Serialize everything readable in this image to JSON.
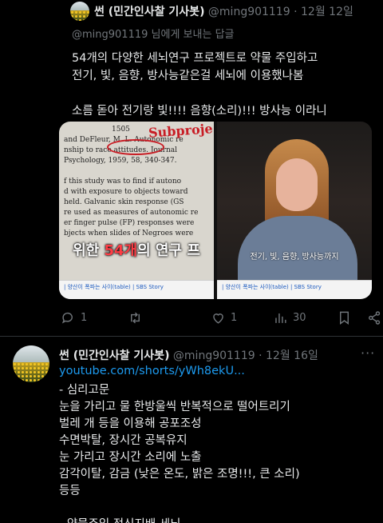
{
  "tweet1": {
    "author_name": "썬 (민간인사찰 기사봇)",
    "handle": "@ming901119",
    "separator": "·",
    "date": "12월 12일",
    "reply_to_handle": "@ming901119",
    "reply_to_suffix": " 님에게 보내는 답글",
    "body_lines": [
      "54개의 다양한 세뇌연구 프로젝트로 약물 주입하고",
      "전기, 빛, 음향, 방사능같은걸 세뇌에 이용했나봄",
      "",
      "소름 돋아 전기랑 빛!!!! 음향(소리)!!! 방사능 이라니"
    ],
    "media": {
      "left_image": {
        "doc_text": [
          "1505",
          "and DeFleur, M. L. Autonomic re",
          "nship to race attitudes. Journal",
          "Psychology, 1959, 58, 340-347.",
          "",
          "f this study was to find if autono",
          "d with exposure to objects toward",
          "held. Galvanic skin response (GS",
          "re used as measures of autonomic re",
          "er finger pulse (FP) responses were",
          "bjects when slides of Negroes were"
        ],
        "handwriting": "Subproje",
        "caption_before": "위한 ",
        "caption_highlight": "54개",
        "caption_after": "의 연구 프",
        "bar_text": "| 양산이 폭파는 사이(table) | SBS Story"
      },
      "right_image": {
        "subtitle": "전기, 빛, 음향, 방사능까지",
        "bar_text": "| 양산이 폭파는 사이(table) | SBS Story"
      }
    },
    "actions": {
      "reply_count": "1",
      "retweet_count": "",
      "like_count": "1",
      "view_count": "30"
    }
  },
  "tweet2": {
    "author_name": "썬 (민간인사찰 기사봇)",
    "handle": "@ming901119",
    "separator": "·",
    "date": "12월 16일",
    "more": "···",
    "link": "youtube.com/shorts/yWh8ekU...",
    "body_lines": [
      "- 심리고문",
      "눈을 가리고 물 한방울씩 반복적으로 떨어트리기",
      "벌레 개 등을 이용해 공포조성",
      "수면박탈, 장시간 공복유지",
      "눈 가리고 장시간 소리에 노출",
      "감각이탈, 감금 (낮은 온도, 밝은 조명!!!, 큰 소리)",
      "등등",
      "",
      "- 약물주입 정신지배 세뇌"
    ]
  },
  "colors": {
    "background": "#000000",
    "text": "#e7e9ea",
    "muted": "#71767b",
    "link": "#1d9bf0",
    "divider": "#2f3336",
    "highlight_red": "#ff3d45"
  }
}
